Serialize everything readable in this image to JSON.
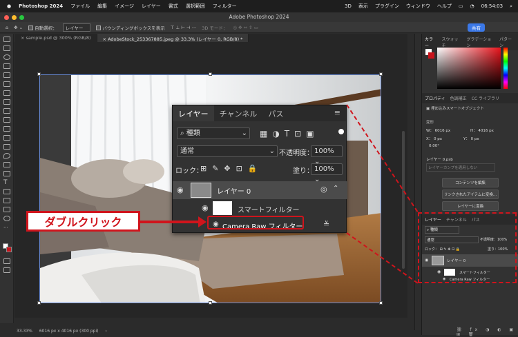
{
  "menubar": {
    "app": "Photoshop 2024",
    "items": [
      "ファイル",
      "編集",
      "イメージ",
      "レイヤー",
      "書式",
      "選択範囲",
      "フィルター",
      "3D",
      "表示",
      "プラグイン",
      "ウィンドウ",
      "ヘルプ"
    ],
    "time": "06:54:03"
  },
  "window_title": "Adobe Photoshop 2024",
  "options": {
    "auto_select": "自動選択：",
    "auto_select_value": "レイヤー",
    "bounding_box": "バウンディングボックスを表示",
    "mode_3d": "3D モード：",
    "share": "共有"
  },
  "tabs": [
    {
      "label": "sample.psd @ 300% (RGB/8)"
    },
    {
      "label": "AdobeStock_253367885.jpeg @ 33.3% (レイヤー 0, RGB/8) *"
    }
  ],
  "status": {
    "zoom": "33.33%",
    "dims": "6016 px x 4016 px (300 ppi)"
  },
  "big_layers": {
    "tabs": [
      "レイヤー",
      "チャンネル",
      "パス"
    ],
    "filter_kind": "種類",
    "blend_mode": "通常",
    "opacity_label": "不透明度：",
    "opacity_value": "100%",
    "lock_label": "ロック：",
    "fill_label": "塗り：",
    "fill_value": "100%",
    "layer0": "レイヤー 0",
    "smart_filter": "スマートフィルター",
    "camera_raw": "Camera Raw フィルター"
  },
  "callout": "ダブルクリック",
  "right_panel": {
    "color_tabs": [
      "カラー",
      "スウォッチ",
      "グラデーション",
      "パターン"
    ],
    "prop_tabs": [
      "プロパティ",
      "色調補正",
      "CC ライブラリ"
    ],
    "smart_obj": "埋め込みスマートオブジェクト",
    "transform": "変形",
    "w": "W： 6016 px",
    "h": "H： 4016 px",
    "x": "X： 0 px",
    "y": "Y： 0 px",
    "angle": "0.00°",
    "psb": "レイヤー 0.psb",
    "comp": "レイヤーカンプを適用しない",
    "btn1": "コンテンツを編集",
    "btn2": "リンクされたアイテムに変換...",
    "btn3": "レイヤーに変換",
    "layers_tabs": [
      "レイヤー",
      "チャンネル",
      "パス"
    ],
    "kind": "種類",
    "blend": "通常",
    "opacity": "不透明度：100%",
    "lock": "ロック：",
    "fill": "塗り：100%",
    "layer0": "レイヤー 0",
    "smart_filter": "スマートフィルター",
    "camera_raw": "Camera Raw フィルター"
  }
}
